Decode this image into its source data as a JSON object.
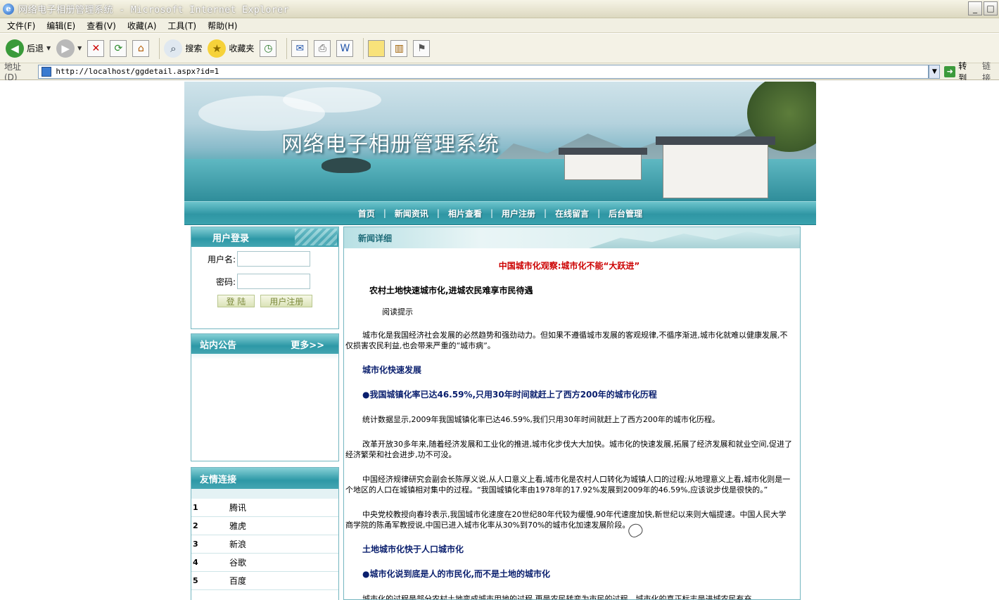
{
  "window": {
    "title": "网络电子相册管理系统 - Microsoft Internet Explorer",
    "min": "_",
    "max": "□"
  },
  "menu": [
    "文件(F)",
    "编辑(E)",
    "查看(V)",
    "收藏(A)",
    "工具(T)",
    "帮助(H)"
  ],
  "toolbar": {
    "back": "后退",
    "search": "搜索",
    "favorites": "收藏夹"
  },
  "address": {
    "label": "地址(D)",
    "url": "http://localhost/ggdetail.aspx?id=1",
    "go": "转到",
    "links": "链接"
  },
  "site": {
    "title": "网络电子相册管理系统",
    "nav": [
      "首页",
      "新闻资讯",
      "相片查看",
      "用户注册",
      "在线留言",
      "后台管理"
    ]
  },
  "login": {
    "title": "用户登录",
    "username_label": "用户名:",
    "password_label": "密码:",
    "login_btn": "登 陆",
    "register_btn": "用户注册"
  },
  "notice": {
    "title": "站内公告",
    "more": "更多>>"
  },
  "friend_links": {
    "title": "友情连接",
    "items": [
      {
        "n": "1",
        "name": "腾讯"
      },
      {
        "n": "2",
        "name": "雅虎"
      },
      {
        "n": "3",
        "name": "新浪"
      },
      {
        "n": "4",
        "name": "谷歌"
      },
      {
        "n": "5",
        "name": "百度"
      }
    ]
  },
  "news": {
    "header": "新闻详细",
    "title": "中国城市化观察:城市化不能“大跃进”",
    "subtitle": "农村土地快速城市化,进城农民难享市民待遇",
    "tip": "阅读提示",
    "p1": "城市化是我国经济社会发展的必然趋势和强劲动力。但如果不遵循城市发展的客观规律,不循序渐进,城市化就难以健康发展,不仅损害农民利益,也会带来严重的“城市病”。",
    "h1": "城市化快速发展",
    "h2": "●我国城镇化率已达46.59%,只用30年时间就赶上了西方200年的城市化历程",
    "p2": "统计数据显示,2009年我国城镇化率已达46.59%,我们只用30年时间就赶上了西方200年的城市化历程。",
    "p3": "改革开放30多年来,随着经济发展和工业化的推进,城市化步伐大大加快。城市化的快速发展,拓展了经济发展和就业空间,促进了经济繁荣和社会进步,功不可没。",
    "p4": "中国经济规律研究会副会长陈厚义说,从人口意义上看,城市化是农村人口转化为城镇人口的过程;从地理意义上看,城市化则是一个地区的人口在城镇相对集中的过程。“我国城镇化率由1978年的17.92%发展到2009年的46.59%,应该说步伐是很快的。”",
    "p5": "中央党校教授向春玲表示,我国城市化速度在20世纪80年代较为缓慢,90年代速度加快,新世纪以来则大幅提速。中国人民大学商学院的陈甬军教授说,中国已进入城市化率从30%到70%的城市化加速发展阶段。",
    "h3": "土地城市化快于人口城市化",
    "h4": "●城市化说到底是人的市民化,而不是土地的城市化",
    "p6": "城市化的过程是部分农村土地变成城市用地的过程,更是农民转变为市民的过程。城市化的真正标志是进城农民有充"
  }
}
